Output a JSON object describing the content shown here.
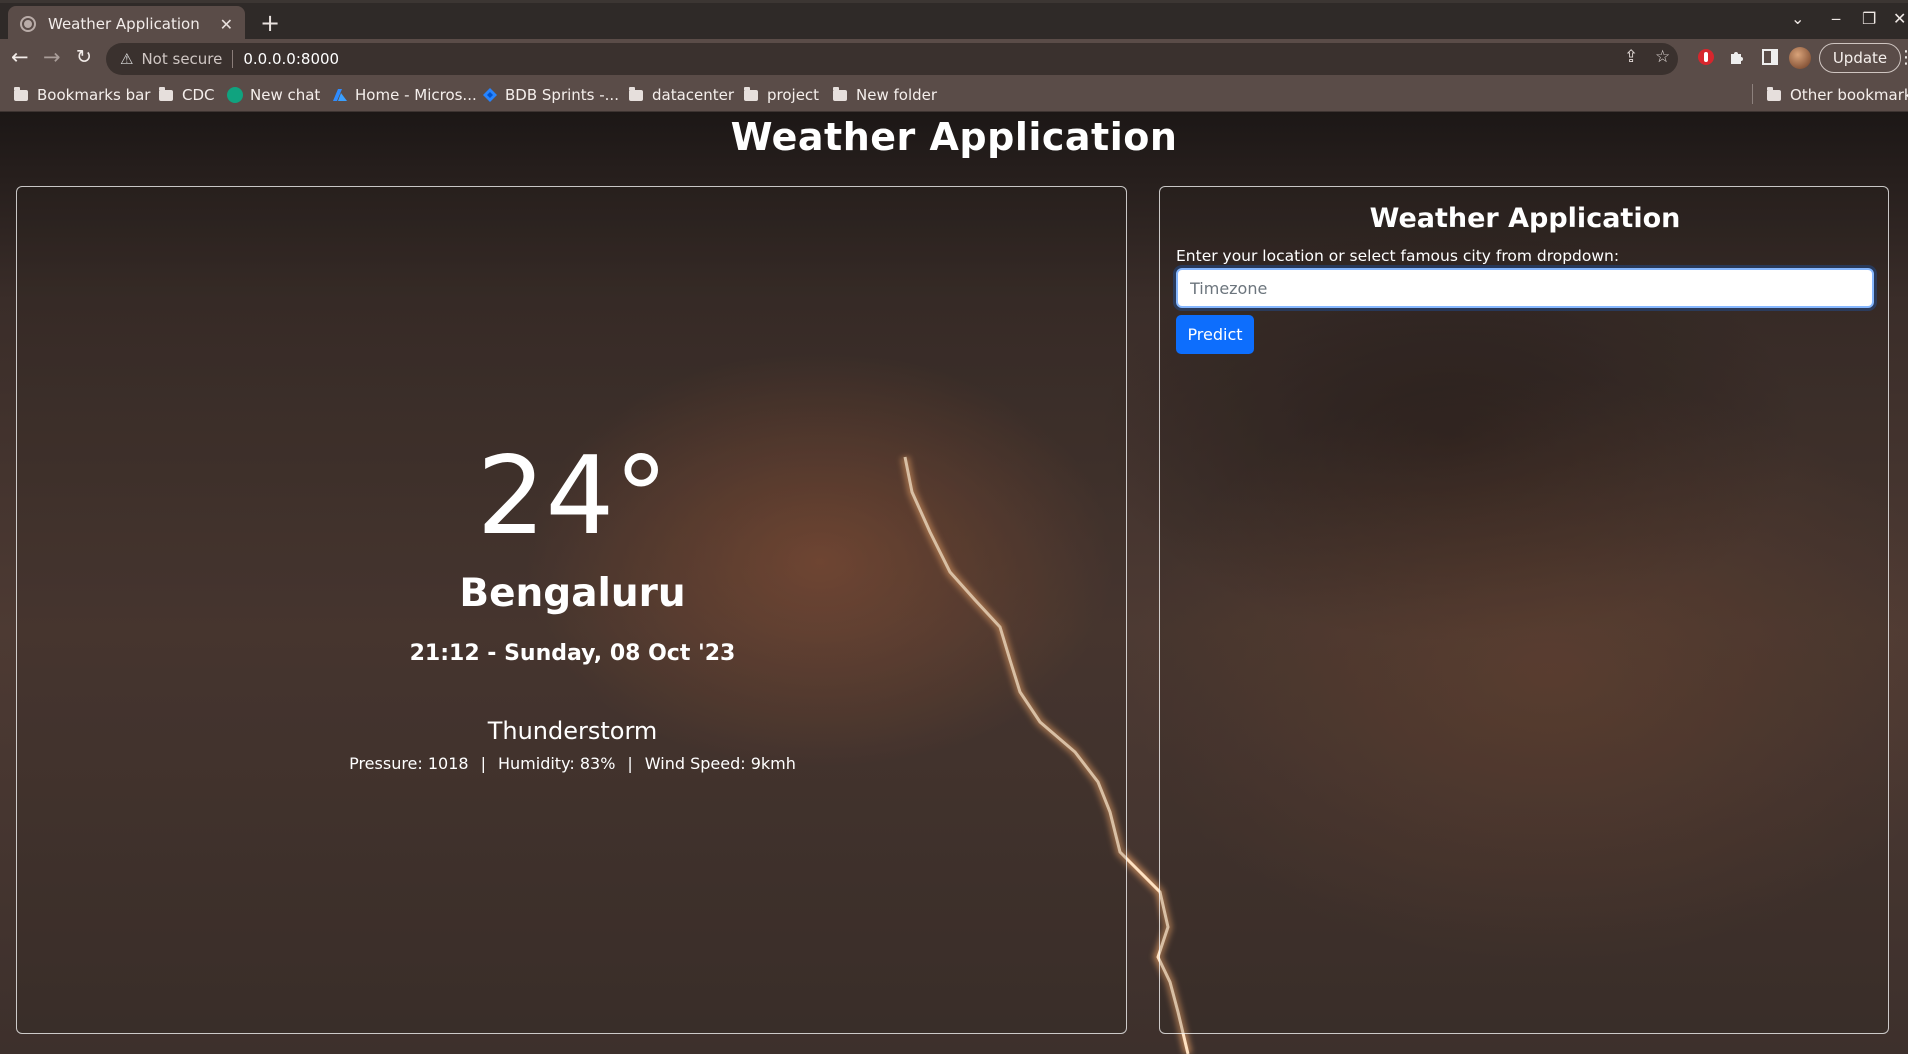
{
  "browser": {
    "tab_title": "Weather Application",
    "tab_close": "✕",
    "new_tab": "+",
    "security_label": "Not secure",
    "url": "0.0.0.0:8000",
    "update_label": "Update",
    "bookmarks": [
      {
        "label": "Bookmarks bar",
        "icon": "folder-icon"
      },
      {
        "label": "CDC",
        "icon": "folder-icon"
      },
      {
        "label": "New chat",
        "icon": "chatgpt-icon"
      },
      {
        "label": "Home - Micros...",
        "icon": "azure-icon"
      },
      {
        "label": "BDB Sprints -...",
        "icon": "jira-icon"
      },
      {
        "label": "datacenter",
        "icon": "folder-icon"
      },
      {
        "label": "project",
        "icon": "folder-icon"
      },
      {
        "label": "New folder",
        "icon": "folder-icon"
      }
    ],
    "other_bookmarks": "Other bookmarks"
  },
  "page": {
    "title": "Weather Application"
  },
  "weather": {
    "temperature": "24°",
    "city": "Bengaluru",
    "datetime": "21:12 - Sunday, 08 Oct '23",
    "condition": "Thunderstorm",
    "pressure": "Pressure: 1018",
    "humidity": "Humidity: 83%",
    "wind": "Wind Speed: 9kmh",
    "separator": "|"
  },
  "form": {
    "title": "Weather Application",
    "label": "Enter your location or select famous city from dropdown:",
    "placeholder": "Timezone",
    "value": "",
    "button_label": "Predict"
  },
  "colors": {
    "accent": "#0d6efd",
    "chrome": "#5a4c48"
  }
}
